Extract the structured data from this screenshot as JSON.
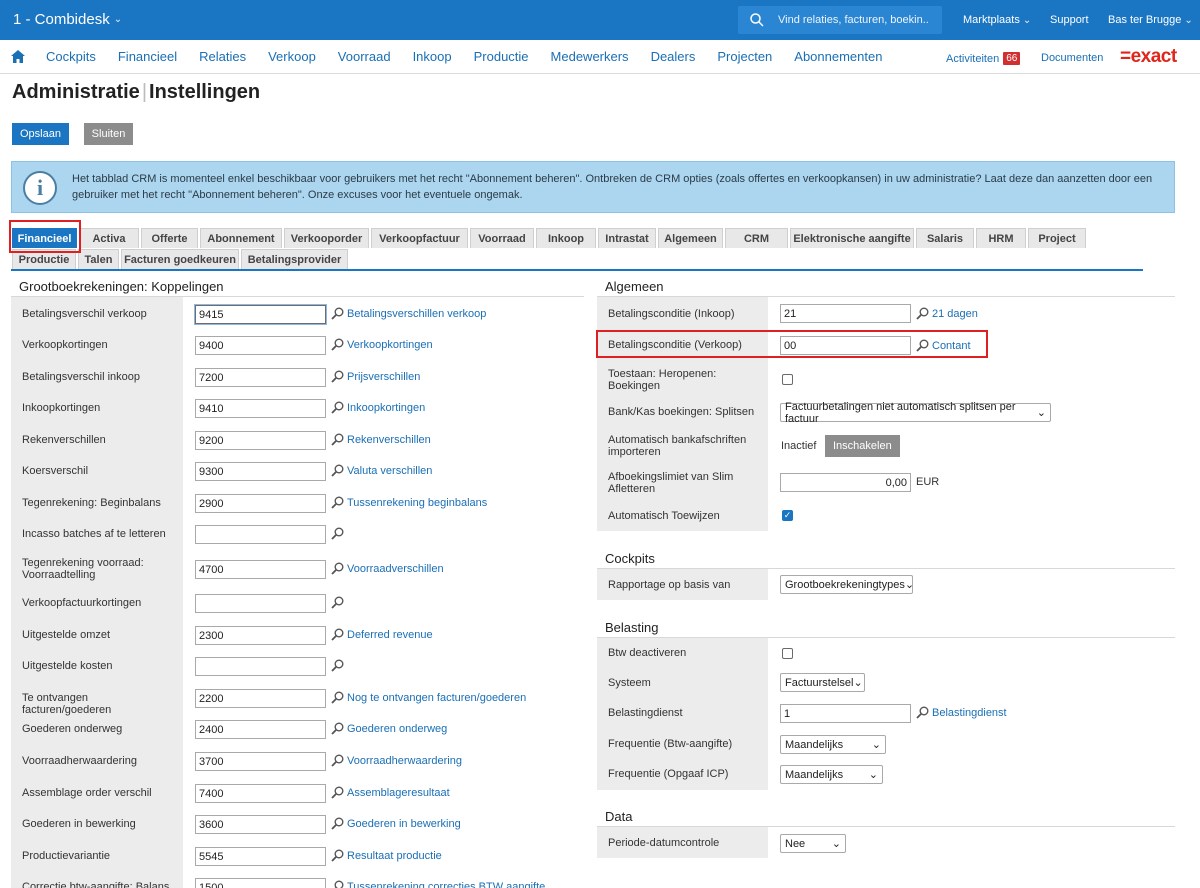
{
  "topbar": {
    "company": "1 - Combidesk",
    "search_placeholder": "Vind relaties, facturen, boekin...",
    "marktplaats": "Marktplaats",
    "support": "Support",
    "user": "Bas ter Brugge"
  },
  "menu": {
    "items": [
      "Cockpits",
      "Financieel",
      "Relaties",
      "Verkoop",
      "Voorraad",
      "Inkoop",
      "Productie",
      "Medewerkers",
      "Dealers",
      "Projecten",
      "Abonnementen"
    ],
    "activiteiten": "Activiteiten",
    "activiteiten_count": "66",
    "documenten": "Documenten",
    "logo": "=exact"
  },
  "page": {
    "title_part1": "Administratie",
    "title_part2": "Instellingen",
    "save": "Opslaan",
    "close": "Sluiten"
  },
  "info": {
    "message": "Het tabblad CRM is momenteel enkel beschikbaar voor gebruikers met het recht \"Abonnement beheren\". Ontbreken de CRM opties (zoals offertes en verkoopkansen) in uw administratie? Laat deze dan aanzetten door een gebruiker met het recht \"Abonnement beheren\". Onze excuses voor het eventuele ongemak."
  },
  "tabs": {
    "row1": [
      "Financieel",
      "Activa",
      "Offerte",
      "Abonnement",
      "Verkooporder",
      "Verkoopfactuur",
      "Voorraad",
      "Inkoop",
      "Intrastat",
      "Algemeen",
      "CRM",
      "Elektronische aangifte",
      "Salaris",
      "HRM",
      "Project"
    ],
    "row2": [
      "Productie",
      "Talen",
      "Facturen goedkeuren",
      "Betalingsprovider"
    ]
  },
  "left": {
    "title": "Grootboekrekeningen: Koppelingen",
    "rows": [
      {
        "label": "Betalingsverschil verkoop",
        "value": "9415",
        "link": "Betalingsverschillen verkoop"
      },
      {
        "label": "Verkoopkortingen",
        "value": "9400",
        "link": "Verkoopkortingen"
      },
      {
        "label": "Betalingsverschil inkoop",
        "value": "7200",
        "link": "Prijsverschillen"
      },
      {
        "label": "Inkoopkortingen",
        "value": "9410",
        "link": "Inkoopkortingen"
      },
      {
        "label": "Rekenverschillen",
        "value": "9200",
        "link": "Rekenverschillen"
      },
      {
        "label": "Koersverschil",
        "value": "9300",
        "link": "Valuta verschillen"
      },
      {
        "label": "Tegenrekening: Beginbalans",
        "value": "2900",
        "link": "Tussenrekening beginbalans"
      },
      {
        "label": "Incasso batches af te letteren",
        "value": "",
        "link": ""
      },
      {
        "label": "Tegenrekening voorraad: Voorraadtelling",
        "value": "4700",
        "link": "Voorraadverschillen"
      },
      {
        "label": "Verkoopfactuurkortingen",
        "value": "",
        "link": ""
      },
      {
        "label": "Uitgestelde omzet",
        "value": "2300",
        "link": "Deferred revenue"
      },
      {
        "label": "Uitgestelde kosten",
        "value": "",
        "link": ""
      },
      {
        "label": "Te ontvangen facturen/goederen",
        "value": "2200",
        "link": "Nog te ontvangen facturen/goederen"
      },
      {
        "label": "Goederen onderweg",
        "value": "2400",
        "link": "Goederen onderweg"
      },
      {
        "label": "Voorraadherwaardering",
        "value": "3700",
        "link": "Voorraadherwaardering"
      },
      {
        "label": "Assemblage order verschil",
        "value": "7400",
        "link": "Assemblageresultaat"
      },
      {
        "label": "Goederen in bewerking",
        "value": "3600",
        "link": "Goederen in bewerking"
      },
      {
        "label": "Productievariantie",
        "value": "5545",
        "link": "Resultaat productie"
      },
      {
        "label": "Correctie btw-aangifte: Balans",
        "value": "1500",
        "link": "Tussenrekening correcties BTW aangifte"
      }
    ]
  },
  "algemeen": {
    "title": "Algemeen",
    "betcond_inkoop_label": "Betalingsconditie (Inkoop)",
    "betcond_inkoop_value": "21",
    "betcond_inkoop_link": "21 dagen",
    "betcond_verkoop_label": "Betalingsconditie (Verkoop)",
    "betcond_verkoop_value": "00",
    "betcond_verkoop_link": "Contant",
    "heropenen_label": "Toestaan: Heropenen: Boekingen",
    "splitsen_label": "Bank/Kas boekingen: Splitsen",
    "splitsen_value": "Factuurbetalingen niet automatisch splitsen per factuur",
    "bankafschriften_label": "Automatisch bankafschriften importeren",
    "bankafschriften_status": "Inactief",
    "bankafschriften_button": "Inschakelen",
    "afboekingslimiet_label": "Afboekingslimiet van Slim Afletteren",
    "afboekingslimiet_value": "0,00",
    "afboekingslimiet_unit": "EUR",
    "toewijzen_label": "Automatisch Toewijzen"
  },
  "cockpits": {
    "title": "Cockpits",
    "rapportage_label": "Rapportage op basis van",
    "rapportage_value": "Grootboekrekeningtypes"
  },
  "belasting": {
    "title": "Belasting",
    "btw_label": "Btw deactiveren",
    "systeem_label": "Systeem",
    "systeem_value": "Factuurstelsel",
    "dienst_label": "Belastingdienst",
    "dienst_value": "1",
    "dienst_link": "Belastingdienst",
    "freq_btw_label": "Frequentie (Btw-aangifte)",
    "freq_btw_value": "Maandelijks",
    "freq_icp_label": "Frequentie (Opgaaf ICP)",
    "freq_icp_value": "Maandelijks"
  },
  "data_section": {
    "title": "Data",
    "periode_label": "Periode-datumcontrole",
    "periode_value": "Nee"
  }
}
